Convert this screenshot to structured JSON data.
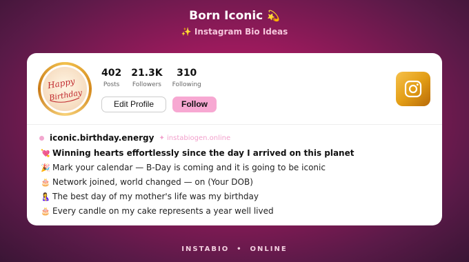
{
  "header": {
    "title": "Born Iconic",
    "title_emoji": "💫",
    "subtitle_emoji": "✨",
    "subtitle": "Instagram Bio Ideas"
  },
  "profile": {
    "avatar_text_line1": "Happy",
    "avatar_text_line2": "Birthday",
    "stats": [
      {
        "value": "402",
        "label": "Posts"
      },
      {
        "value": "21.3K",
        "label": "Followers"
      },
      {
        "value": "310",
        "label": "Following"
      }
    ],
    "edit_label": "Edit Profile",
    "follow_label": "Follow",
    "instagram_icon": "instagram-icon"
  },
  "bio": {
    "handle": "iconic.birthday.energy",
    "watermark": "✦ instabiogen.online",
    "lines": [
      {
        "emoji": "💘",
        "text": "Winning hearts effortlessly since the day I arrived on this planet"
      },
      {
        "emoji": "🎉",
        "text": "Mark your calendar — B-Day is coming and it is going to be iconic"
      },
      {
        "emoji": "🎂",
        "text": "Network joined, world changed — on (Your DOB)"
      },
      {
        "emoji": "🤱",
        "text": "The best day of my mother's life was my birthday"
      },
      {
        "emoji": "🎂",
        "text": "Every candle on my cake represents a year well lived"
      }
    ]
  },
  "footer": {
    "text": "INSTABIO  •  ONLINE"
  },
  "colors": {
    "background": "#9a1a5c",
    "accent_pink": "#f7a8d2",
    "gold": "#e39e16"
  }
}
